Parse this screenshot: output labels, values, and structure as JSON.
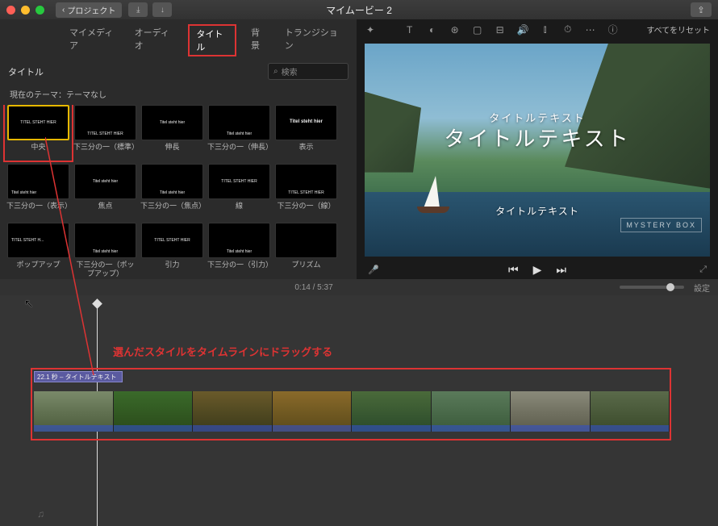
{
  "titlebar": {
    "back": "プロジェクト",
    "title": "マイムービー 2"
  },
  "tabs": {
    "media": "マイメディア",
    "audio": "オーディオ",
    "titles": "タイトル",
    "backgrounds": "背景",
    "transitions": "トランジション"
  },
  "browser": {
    "section": "タイトル",
    "search_placeholder": "検索",
    "theme": "現在のテーマ：テーマなし",
    "tiles": [
      {
        "name": "中央",
        "text": "TITEL STEHT HIER",
        "sel": true,
        "hl": true
      },
      {
        "name": "下三分の一（標準）",
        "text": "TITEL STEHT HIER",
        "bottom": true
      },
      {
        "name": "伸長",
        "text": "Titel steht hier"
      },
      {
        "name": "下三分の一（伸長）",
        "text": "Titel steht hier",
        "bottom": true
      },
      {
        "name": "表示",
        "text": "Titel steht hier",
        "big": true
      },
      {
        "name": "下三分の一（表示）",
        "text": "Titel steht hier",
        "left": true,
        "bottom": true
      },
      {
        "name": "焦点",
        "text": "Titel steht hier"
      },
      {
        "name": "下三分の一（焦点）",
        "text": "Titel steht hier",
        "bottom": true
      },
      {
        "name": "線",
        "text": "TITEL STEHT HIER"
      },
      {
        "name": "下三分の一（線）",
        "text": "TITEL STEHT HIER",
        "bottom": true
      },
      {
        "name": "ポップアップ",
        "text": "TITEL STEHT H...",
        "left": true
      },
      {
        "name": "下三分の一（ポップアップ）",
        "text": "Titel steht hier",
        "bottom": true
      },
      {
        "name": "引力",
        "text": "TITEL STEHT HIER"
      },
      {
        "name": "下三分の一（引力）",
        "text": "Titel steht hier",
        "bottom": true
      },
      {
        "name": "プリズム",
        "text": ""
      }
    ]
  },
  "inspector": {
    "reset": "すべてをリセット"
  },
  "preview": {
    "subtitle_top": "タイトルテキスト",
    "title": "タイトルテキスト",
    "subtitle_bottom": "タイトルテキスト",
    "watermark": "MYSTERY BOX"
  },
  "timecode": {
    "current": "0:14",
    "total": "5:37",
    "settings": "設定"
  },
  "timeline": {
    "annotation": "選んだスタイルをタイムラインにドラッグする",
    "clip_label": "22.1 秒 – タイトルテキスト"
  }
}
